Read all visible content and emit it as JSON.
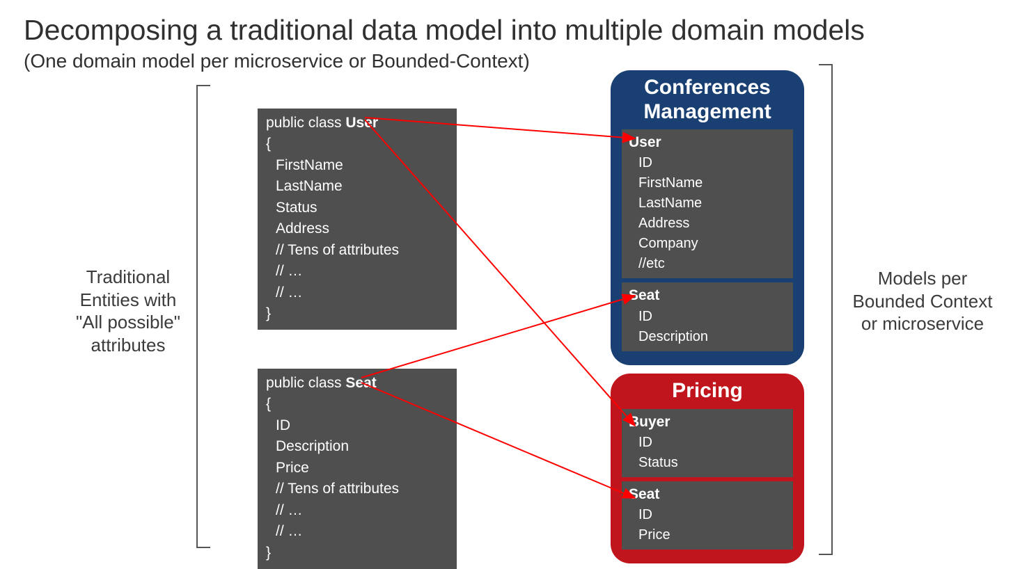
{
  "title": "Decomposing a traditional data model into multiple domain models",
  "subtitle": "(One domain model per microservice or Bounded-Context)",
  "leftLabel": "Traditional Entities with \"All possible\" attributes",
  "rightLabel": "Models per Bounded Context or microservice",
  "colors": {
    "codeBox": "#4f4f4f",
    "bcBlue": "#1a3f73",
    "bcRed": "#c0151c",
    "arrow": "#ff0000"
  },
  "traditional": {
    "user": {
      "decl_prefix": "public class ",
      "decl_class": "User",
      "lines": [
        "{",
        "  FirstName",
        "  LastName",
        "  Status",
        "  Address",
        "  // Tens of attributes",
        "  // …",
        "  // …",
        "}"
      ]
    },
    "seat": {
      "decl_prefix": "public class ",
      "decl_class": "Seat",
      "lines": [
        "{",
        "  ID",
        "  Description",
        "  Price",
        "  // Tens of attributes",
        "  // …",
        "  // …",
        "}"
      ]
    }
  },
  "contexts": {
    "conferences": {
      "title": "Conferences Management",
      "entities": [
        {
          "name": "User",
          "attrs": [
            "ID",
            "FirstName",
            "LastName",
            "Address",
            "Company",
            "//etc"
          ]
        },
        {
          "name": "Seat",
          "attrs": [
            "ID",
            "Description"
          ]
        }
      ]
    },
    "pricing": {
      "title": "Pricing",
      "entities": [
        {
          "name": "Buyer",
          "attrs": [
            "ID",
            "Status"
          ]
        },
        {
          "name": "Seat",
          "attrs": [
            "ID",
            "Price"
          ]
        }
      ]
    }
  }
}
